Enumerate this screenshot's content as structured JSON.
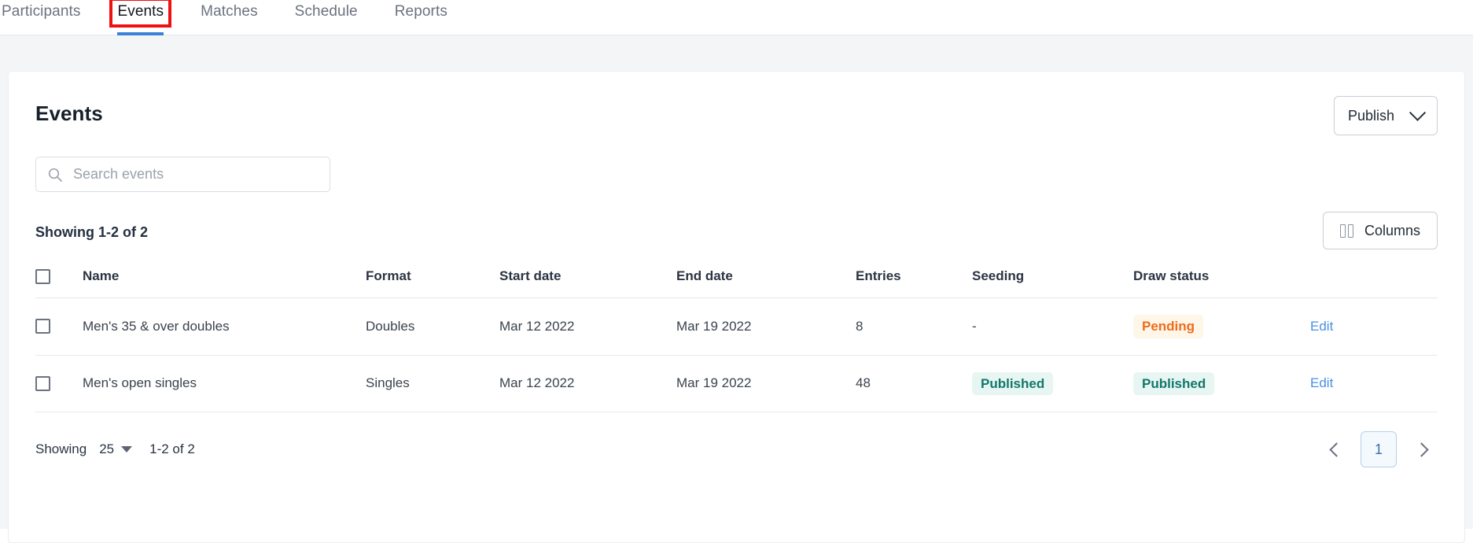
{
  "nav": {
    "items": [
      {
        "label": "Participants",
        "active": false
      },
      {
        "label": "Events",
        "active": true
      },
      {
        "label": "Matches",
        "active": false
      },
      {
        "label": "Schedule",
        "active": false
      },
      {
        "label": "Reports",
        "active": false
      }
    ],
    "annotation_color": "#ee1111",
    "active_underline_color": "#3b82d6"
  },
  "card": {
    "title": "Events",
    "publish_button": {
      "label": "Publish",
      "icon": "chevron-down-icon"
    },
    "search": {
      "placeholder": "Search events",
      "value": "",
      "icon": "search-icon"
    },
    "showing_count": "Showing 1-2 of 2",
    "columns_button": {
      "label": "Columns",
      "icon": "columns-icon"
    }
  },
  "table": {
    "headers": {
      "select": "",
      "name": "Name",
      "format": "Format",
      "start_date": "Start date",
      "end_date": "End date",
      "entries": "Entries",
      "seeding": "Seeding",
      "draw_status": "Draw status",
      "action": ""
    },
    "rows": [
      {
        "name": "Men's 35 & over doubles",
        "format": "Doubles",
        "start_date": "Mar 12 2022",
        "end_date": "Mar 19 2022",
        "entries": "8",
        "seeding": "-",
        "seeding_is_badge": false,
        "draw_status": "Pending",
        "draw_status_kind": "pending",
        "action": "Edit"
      },
      {
        "name": "Men's open singles",
        "format": "Singles",
        "start_date": "Mar 12 2022",
        "end_date": "Mar 19 2022",
        "entries": "48",
        "seeding": "Published",
        "seeding_is_badge": true,
        "draw_status": "Published",
        "draw_status_kind": "published",
        "action": "Edit"
      }
    ]
  },
  "footer": {
    "showing_label": "Showing",
    "page_size": "25",
    "range": "1-2 of 2",
    "pagination": {
      "prev_icon": "chevron-left-icon",
      "next_icon": "chevron-right-icon",
      "current_page": "1"
    }
  },
  "colors": {
    "accent_blue": "#4a90e2",
    "pending_text": "#ef6c1a",
    "pending_bg": "#fdf6e9",
    "published_text": "#12776a",
    "published_bg": "#e7f6f2",
    "page_bg": "#f4f5f7"
  }
}
